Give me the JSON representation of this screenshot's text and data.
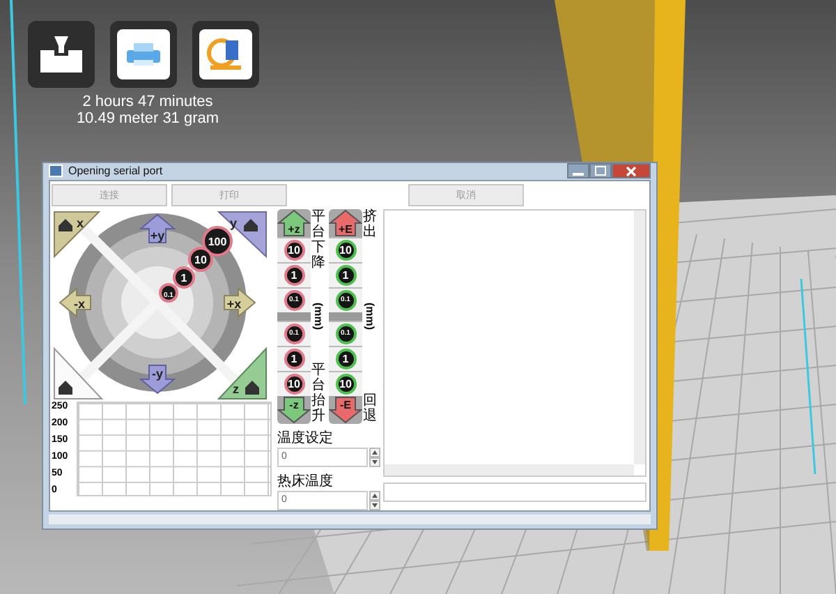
{
  "print_stats": [
    "2 hours 47 minutes",
    "10.49 meter 31 gram"
  ],
  "window": {
    "title": "Opening serial port"
  },
  "buttons": [
    {
      "label": "连接",
      "disabled": true
    },
    {
      "label": "打印",
      "disabled": true
    },
    {
      "label": "取消",
      "disabled": true
    }
  ],
  "jog": {
    "home_x": "x",
    "home_y": "y",
    "home_z": "z",
    "plus_y": "+y",
    "minus_y": "-y",
    "minus_x": "-x",
    "plus_x": "+x",
    "steps": [
      "100",
      "10",
      "1",
      "0.1"
    ]
  },
  "columns": [
    {
      "kind": "z",
      "top_label": "平台下降",
      "unit": "(mm)",
      "bottom_label": "平台抬升",
      "up": "+z",
      "down": "-z",
      "up_steps": [
        "10",
        "1",
        "0.1"
      ],
      "down_steps": [
        "0.1",
        "1",
        "10"
      ]
    },
    {
      "kind": "e",
      "top_label": "挤出",
      "unit": "(mm)",
      "bottom_label": "回退",
      "up": "+E",
      "down": "-E",
      "up_steps": [
        "10",
        "1",
        "0.1"
      ],
      "down_steps": [
        "0.1",
        "1",
        "10"
      ]
    }
  ],
  "graph": {
    "y_labels": [
      "250",
      "200",
      "150",
      "100",
      "50",
      "0"
    ]
  },
  "temperatures": [
    {
      "label": "温度设定",
      "value": "0"
    },
    {
      "label": "热床温度",
      "value": "0"
    }
  ]
}
